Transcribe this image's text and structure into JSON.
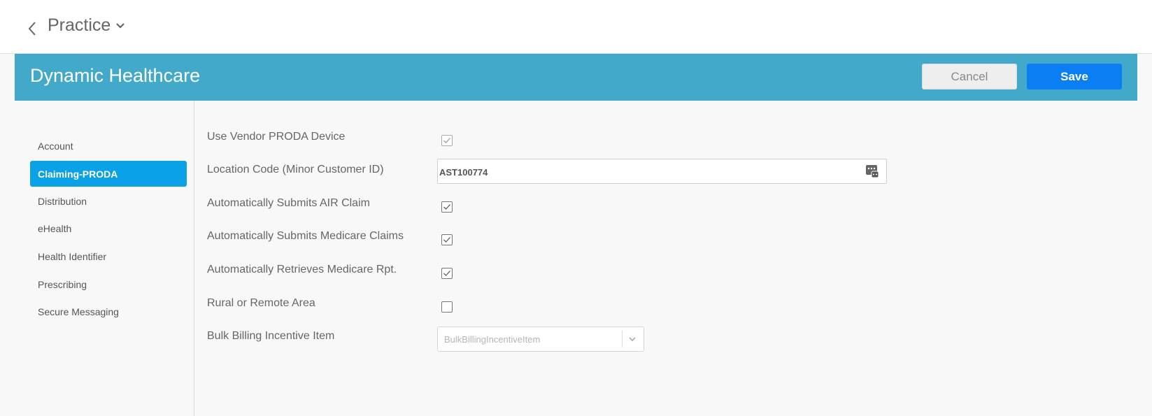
{
  "header": {
    "back_icon": "chevron-left-icon",
    "title": "Practice",
    "title_dropdown_icon": "chevron-down-icon"
  },
  "banner": {
    "org_name": "Dynamic Healthcare",
    "cancel_label": "Cancel",
    "save_label": "Save",
    "color": "#42a9ca",
    "save_color": "#0a7ff3"
  },
  "sidebar": {
    "active_color": "#0aa1e6",
    "items": [
      {
        "label": "Account",
        "active": false
      },
      {
        "label": "Claiming-PRODA",
        "active": true
      },
      {
        "label": "Distribution",
        "active": false
      },
      {
        "label": "eHealth",
        "active": false
      },
      {
        "label": "Health Identifier",
        "active": false
      },
      {
        "label": "Prescribing",
        "active": false
      },
      {
        "label": "Secure Messaging",
        "active": false
      }
    ]
  },
  "form": {
    "use_vendor_proda": {
      "label": "Use Vendor PRODA Device",
      "checked": true,
      "disabled": true
    },
    "location_code": {
      "label": "Location Code (Minor Customer ID)",
      "value": "AST100774",
      "icon": "lookup-icon"
    },
    "auto_air": {
      "label": "Automatically Submits AIR Claim",
      "checked": true
    },
    "auto_medicare": {
      "label": "Automatically Submits Medicare Claims",
      "checked": true
    },
    "auto_retrieve": {
      "label": "Automatically Retrieves Medicare Rpt.",
      "checked": true
    },
    "rural_remote": {
      "label": "Rural or Remote Area",
      "checked": false
    },
    "bulk_billing": {
      "label": "Bulk Billing Incentive Item",
      "placeholder": "BulkBillingIncentiveItem"
    }
  }
}
